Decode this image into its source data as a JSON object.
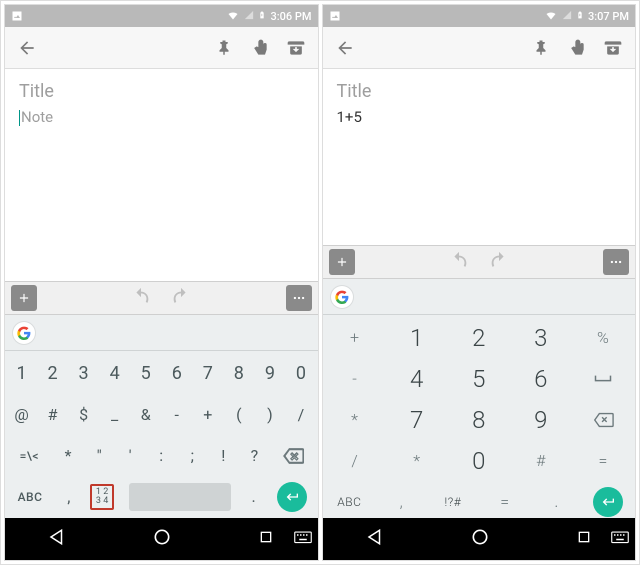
{
  "left": {
    "status": {
      "time": "3:06 PM"
    },
    "note": {
      "title_placeholder": "Title",
      "body_placeholder": "Note",
      "body_value": ""
    },
    "kb": {
      "row1": [
        "1",
        "2",
        "3",
        "4",
        "5",
        "6",
        "7",
        "8",
        "9",
        "0"
      ],
      "row2": [
        "@",
        "#",
        "$",
        "_",
        "&",
        "-",
        "+",
        "(",
        ")",
        "/"
      ],
      "row3": [
        "=\\<",
        "*",
        "\"",
        "'",
        ":",
        ";",
        "!",
        "?"
      ],
      "row4": {
        "abc": "ABC",
        "comma": ",",
        "numtoggle_top": "1 2",
        "numtoggle_bot": "3 4",
        "period": "."
      }
    }
  },
  "right": {
    "status": {
      "time": "3:07 PM"
    },
    "note": {
      "title_placeholder": "Title",
      "body_value": "1+5"
    },
    "kb": {
      "side_left": [
        "+",
        "-",
        "*",
        "/"
      ],
      "main": [
        [
          "1",
          "2",
          "3"
        ],
        [
          "4",
          "5",
          "6"
        ],
        [
          "7",
          "8",
          "9"
        ],
        [
          "*",
          "0",
          "#"
        ]
      ],
      "side_right": [
        "%",
        "␣",
        "="
      ],
      "row4": {
        "abc": "ABC",
        "comma": ",",
        "sym": "!?#",
        "eq": "=",
        "period": "."
      }
    }
  }
}
